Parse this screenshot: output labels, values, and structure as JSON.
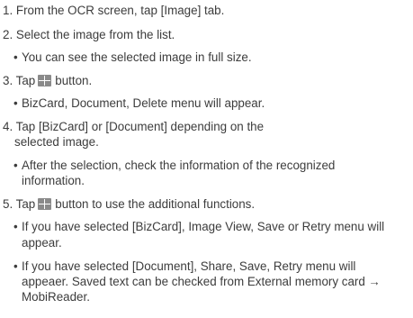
{
  "steps": [
    {
      "text": "1. From the OCR screen, tap [Image] tab."
    },
    {
      "text": "2. Select the image from the list."
    },
    {
      "text": "You can see the selected image in full size."
    },
    {
      "before": "3. Tap",
      "after": "button."
    },
    {
      "text": "BizCard, Document, Delete menu will appear."
    },
    {
      "text": "4. Tap [BizCard] or [Document] depending on the"
    },
    {
      "text": "selected image."
    },
    {
      "text": "After the selection, check the information of the recognized"
    },
    {
      "text": "information."
    },
    {
      "before": "5. Tap",
      "after": "button to use the additional functions."
    },
    {
      "text": "If you have selected [BizCard], Image View, Save or Retry menu will"
    },
    {
      "text": "appear."
    },
    {
      "text": "If you have selected [Document], Share, Save, Retry menu will"
    },
    {
      "text": "appeaer. Saved text can be checked from External memory card →"
    },
    {
      "text": "MobiReader."
    }
  ],
  "icons": {
    "menu": "menu-grid-icon"
  }
}
